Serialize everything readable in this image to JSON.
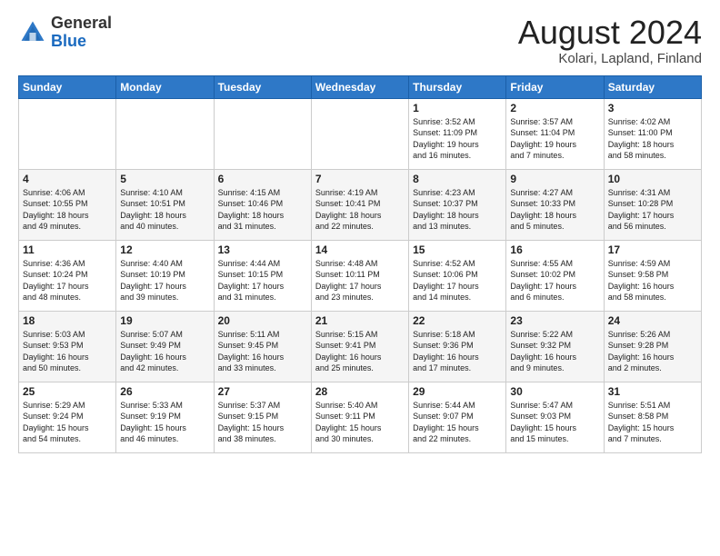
{
  "header": {
    "logo_general": "General",
    "logo_blue": "Blue",
    "month_year": "August 2024",
    "location": "Kolari, Lapland, Finland"
  },
  "weekdays": [
    "Sunday",
    "Monday",
    "Tuesday",
    "Wednesday",
    "Thursday",
    "Friday",
    "Saturday"
  ],
  "weeks": [
    [
      {
        "day": "",
        "info": ""
      },
      {
        "day": "",
        "info": ""
      },
      {
        "day": "",
        "info": ""
      },
      {
        "day": "",
        "info": ""
      },
      {
        "day": "1",
        "info": "Sunrise: 3:52 AM\nSunset: 11:09 PM\nDaylight: 19 hours\nand 16 minutes."
      },
      {
        "day": "2",
        "info": "Sunrise: 3:57 AM\nSunset: 11:04 PM\nDaylight: 19 hours\nand 7 minutes."
      },
      {
        "day": "3",
        "info": "Sunrise: 4:02 AM\nSunset: 11:00 PM\nDaylight: 18 hours\nand 58 minutes."
      }
    ],
    [
      {
        "day": "4",
        "info": "Sunrise: 4:06 AM\nSunset: 10:55 PM\nDaylight: 18 hours\nand 49 minutes."
      },
      {
        "day": "5",
        "info": "Sunrise: 4:10 AM\nSunset: 10:51 PM\nDaylight: 18 hours\nand 40 minutes."
      },
      {
        "day": "6",
        "info": "Sunrise: 4:15 AM\nSunset: 10:46 PM\nDaylight: 18 hours\nand 31 minutes."
      },
      {
        "day": "7",
        "info": "Sunrise: 4:19 AM\nSunset: 10:41 PM\nDaylight: 18 hours\nand 22 minutes."
      },
      {
        "day": "8",
        "info": "Sunrise: 4:23 AM\nSunset: 10:37 PM\nDaylight: 18 hours\nand 13 minutes."
      },
      {
        "day": "9",
        "info": "Sunrise: 4:27 AM\nSunset: 10:33 PM\nDaylight: 18 hours\nand 5 minutes."
      },
      {
        "day": "10",
        "info": "Sunrise: 4:31 AM\nSunset: 10:28 PM\nDaylight: 17 hours\nand 56 minutes."
      }
    ],
    [
      {
        "day": "11",
        "info": "Sunrise: 4:36 AM\nSunset: 10:24 PM\nDaylight: 17 hours\nand 48 minutes."
      },
      {
        "day": "12",
        "info": "Sunrise: 4:40 AM\nSunset: 10:19 PM\nDaylight: 17 hours\nand 39 minutes."
      },
      {
        "day": "13",
        "info": "Sunrise: 4:44 AM\nSunset: 10:15 PM\nDaylight: 17 hours\nand 31 minutes."
      },
      {
        "day": "14",
        "info": "Sunrise: 4:48 AM\nSunset: 10:11 PM\nDaylight: 17 hours\nand 23 minutes."
      },
      {
        "day": "15",
        "info": "Sunrise: 4:52 AM\nSunset: 10:06 PM\nDaylight: 17 hours\nand 14 minutes."
      },
      {
        "day": "16",
        "info": "Sunrise: 4:55 AM\nSunset: 10:02 PM\nDaylight: 17 hours\nand 6 minutes."
      },
      {
        "day": "17",
        "info": "Sunrise: 4:59 AM\nSunset: 9:58 PM\nDaylight: 16 hours\nand 58 minutes."
      }
    ],
    [
      {
        "day": "18",
        "info": "Sunrise: 5:03 AM\nSunset: 9:53 PM\nDaylight: 16 hours\nand 50 minutes."
      },
      {
        "day": "19",
        "info": "Sunrise: 5:07 AM\nSunset: 9:49 PM\nDaylight: 16 hours\nand 42 minutes."
      },
      {
        "day": "20",
        "info": "Sunrise: 5:11 AM\nSunset: 9:45 PM\nDaylight: 16 hours\nand 33 minutes."
      },
      {
        "day": "21",
        "info": "Sunrise: 5:15 AM\nSunset: 9:41 PM\nDaylight: 16 hours\nand 25 minutes."
      },
      {
        "day": "22",
        "info": "Sunrise: 5:18 AM\nSunset: 9:36 PM\nDaylight: 16 hours\nand 17 minutes."
      },
      {
        "day": "23",
        "info": "Sunrise: 5:22 AM\nSunset: 9:32 PM\nDaylight: 16 hours\nand 9 minutes."
      },
      {
        "day": "24",
        "info": "Sunrise: 5:26 AM\nSunset: 9:28 PM\nDaylight: 16 hours\nand 2 minutes."
      }
    ],
    [
      {
        "day": "25",
        "info": "Sunrise: 5:29 AM\nSunset: 9:24 PM\nDaylight: 15 hours\nand 54 minutes."
      },
      {
        "day": "26",
        "info": "Sunrise: 5:33 AM\nSunset: 9:19 PM\nDaylight: 15 hours\nand 46 minutes."
      },
      {
        "day": "27",
        "info": "Sunrise: 5:37 AM\nSunset: 9:15 PM\nDaylight: 15 hours\nand 38 minutes."
      },
      {
        "day": "28",
        "info": "Sunrise: 5:40 AM\nSunset: 9:11 PM\nDaylight: 15 hours\nand 30 minutes."
      },
      {
        "day": "29",
        "info": "Sunrise: 5:44 AM\nSunset: 9:07 PM\nDaylight: 15 hours\nand 22 minutes."
      },
      {
        "day": "30",
        "info": "Sunrise: 5:47 AM\nSunset: 9:03 PM\nDaylight: 15 hours\nand 15 minutes."
      },
      {
        "day": "31",
        "info": "Sunrise: 5:51 AM\nSunset: 8:58 PM\nDaylight: 15 hours\nand 7 minutes."
      }
    ]
  ]
}
